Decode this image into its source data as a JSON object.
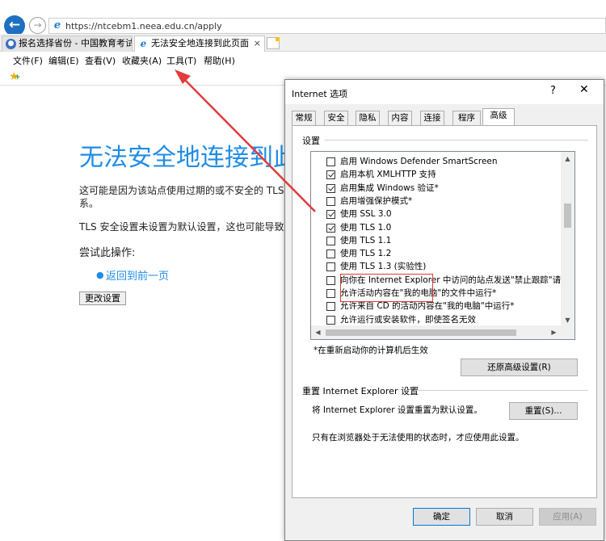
{
  "browser": {
    "url": "https://ntcebm1.neea.edu.cn/apply",
    "tabs": [
      {
        "label": "报名选择省份 - 中国教育考试网"
      },
      {
        "label": "无法安全地连接到此页面"
      }
    ],
    "menu": [
      "文件(F)",
      "编辑(E)",
      "查看(V)",
      "收藏夹(A)",
      "工具(T)",
      "帮助(H)"
    ]
  },
  "page": {
    "title": "无法安全地连接到此",
    "line1": "这可能是因为该站点使用过期的或不安全的 TLS",
    "line1b": "系。",
    "line2": "TLS 安全设置未设置为默认设置，这也可能导致",
    "try_label": "尝试此操作:",
    "back_link": "返回到前一页",
    "change_button": "更改设置"
  },
  "dialog": {
    "title": "Internet 选项",
    "help": "?",
    "close": "✕",
    "tabs": [
      "常规",
      "安全",
      "隐私",
      "内容",
      "连接",
      "程序",
      "高级"
    ],
    "active_tab": "高级",
    "settings_label": "设置",
    "settings": [
      {
        "label": "启用 Windows Defender SmartScreen",
        "checked": false
      },
      {
        "label": "启用本机 XMLHTTP 支持",
        "checked": true
      },
      {
        "label": "启用集成 Windows 验证*",
        "checked": true
      },
      {
        "label": "启用增强保护模式*",
        "checked": false
      },
      {
        "label": "使用 SSL 3.0",
        "checked": true
      },
      {
        "label": "使用 TLS 1.0",
        "checked": true
      },
      {
        "label": "使用 TLS 1.1",
        "checked": false
      },
      {
        "label": "使用 TLS 1.2",
        "checked": false
      },
      {
        "label": "使用 TLS 1.3 (实验性)",
        "checked": false
      },
      {
        "label": "向你在 Internet Explorer 中访问的站点发送\"禁止跟踪\"请求*",
        "checked": false
      },
      {
        "label": "允许活动内容在\"我的电脑\"的文件中运行*",
        "checked": false
      },
      {
        "label": "允许来自 CD 的活动内容在\"我的电脑\"中运行*",
        "checked": false
      },
      {
        "label": "允许运行或安装软件，即使签名无效",
        "checked": false
      }
    ],
    "restart_note": "*在重新启动你的计算机后生效",
    "restore_button": "还原高级设置(R)",
    "reset_group_label": "重置 Internet Explorer 设置",
    "reset_desc": "将 Internet Explorer 设置重置为默认设置。",
    "reset_button": "重置(S)...",
    "reset_note": "只有在浏览器处于无法使用的状态时，才应使用此设置。",
    "ok_button": "确定",
    "cancel_button": "取消",
    "apply_button": "应用(A)"
  }
}
